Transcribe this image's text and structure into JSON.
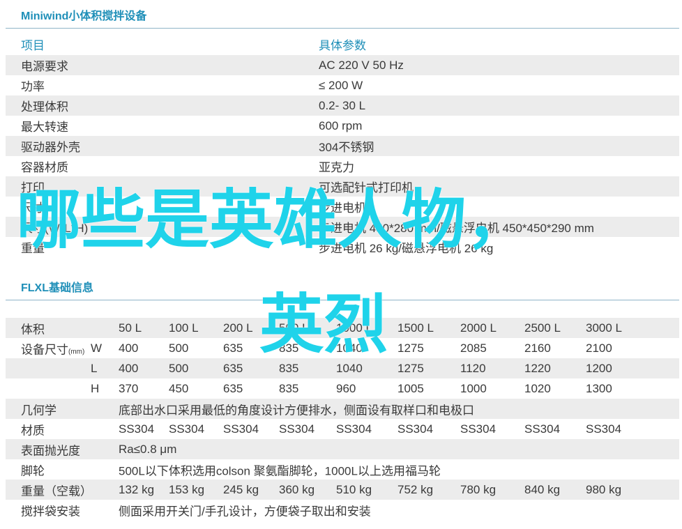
{
  "section1": {
    "title": "Miniwind小体积搅拌设备",
    "header": {
      "item": "项目",
      "param": "具体参数"
    },
    "rows": [
      {
        "label": "电源要求",
        "value": "AC 220 V 50 Hz"
      },
      {
        "label": "功率",
        "value": "≤ 200 W"
      },
      {
        "label": "处理体积",
        "value": "0.2- 30 L"
      },
      {
        "label": "最大转速",
        "value": "600 rpm"
      },
      {
        "label": "驱动器外壳",
        "value": "304不锈钢"
      },
      {
        "label": "容器材质",
        "value": "亚克力"
      },
      {
        "label": "打印",
        "value": "可选配针式打印机"
      },
      {
        "label": "尺寸",
        "value": "步进电机"
      },
      {
        "label": "尺寸(W*L*H)",
        "value": "步进电机 450*280 mm/磁悬浮电机 450*450*290 mm"
      },
      {
        "label": "重量",
        "value": "步进电机 26 kg/磁悬浮电机 26 kg"
      }
    ]
  },
  "section2": {
    "title": "FLXL基础信息",
    "volume": {
      "label": "体积",
      "values": [
        "50 L",
        "100 L",
        "200 L",
        "500 L",
        "1000 L",
        "1500 L",
        "2000 L",
        "2500 L",
        "3000 L"
      ]
    },
    "dims_label": "设备尺寸",
    "dims_unit": "(mm)",
    "dims": [
      {
        "axis": "W",
        "values": [
          "400",
          "500",
          "635",
          "835",
          "1040",
          "1275",
          "2085",
          "2160",
          "2100"
        ]
      },
      {
        "axis": "L",
        "values": [
          "400",
          "500",
          "635",
          "835",
          "1040",
          "1275",
          "1120",
          "1220",
          "1200"
        ]
      },
      {
        "axis": "H",
        "values": [
          "370",
          "450",
          "635",
          "835",
          "960",
          "1005",
          "1000",
          "1020",
          "1300"
        ]
      }
    ],
    "geometry": {
      "label": "几何学",
      "value": "底部出水口采用最低的角度设计方便排水，侧面设有取样口和电极口"
    },
    "material": {
      "label": "材质",
      "values": [
        "SS304",
        "SS304",
        "SS304",
        "SS304",
        "SS304",
        "SS304",
        "SS304",
        "SS304",
        "SS304"
      ]
    },
    "polish": {
      "label": "表面抛光度",
      "value": "Ra≤0.8 μm"
    },
    "casters": {
      "label": "脚轮",
      "value": "500L以下体积选用colson 聚氨酯脚轮，1000L以上选用福马轮"
    },
    "weight": {
      "label": "重量（空载）",
      "values": [
        "132 kg",
        "153 kg",
        "245 kg",
        "360 kg",
        "510 kg",
        "752 kg",
        "780 kg",
        "840 kg",
        "980 kg"
      ]
    },
    "bag": {
      "label": "搅拌袋安装",
      "value": "侧面采用开关门/手孔设计，方便袋子取出和安装"
    }
  },
  "overlay": {
    "line1": "哪些是英雄人物，",
    "line2": "英烈"
  },
  "colors": {
    "accent": "#1f8fb8",
    "overlay": "#1fd3ea",
    "stripe": "#ececec"
  }
}
